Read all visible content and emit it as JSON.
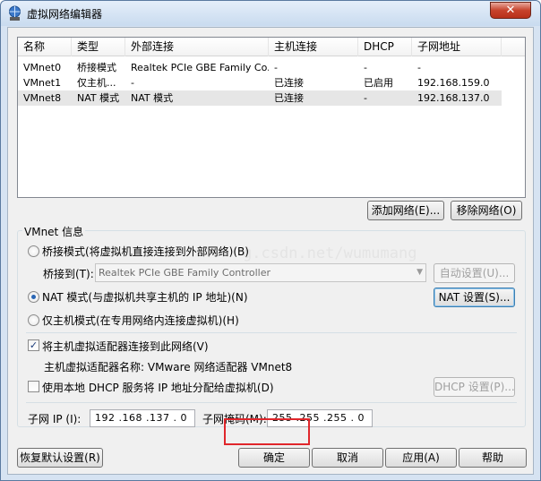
{
  "window": {
    "title": "虚拟网络编辑器",
    "close_glyph": "✕"
  },
  "table": {
    "columns": [
      "名称",
      "类型",
      "外部连接",
      "主机连接",
      "DHCP",
      "子网地址"
    ],
    "rows": [
      [
        "VMnet0",
        "桥接模式",
        "Realtek PCIe GBE Family Co...",
        "-",
        "-",
        "-"
      ],
      [
        "VMnet1",
        "仅主机...",
        "-",
        "已连接",
        "已启用",
        "192.168.159.0"
      ],
      [
        "VMnet8",
        "NAT 模式",
        "NAT 模式",
        "已连接",
        "-",
        "192.168.137.0"
      ]
    ],
    "selected_row": 2
  },
  "net_buttons": {
    "add": "添加网络(E)...",
    "remove": "移除网络(O)"
  },
  "vmnet_info": {
    "group_title": "VMnet 信息",
    "bridged_label": "桥接模式(将虚拟机直接连接到外部网络)(B)",
    "bridge_to_label": "桥接到(T):",
    "bridge_to_value": "Realtek PCIe GBE Family Controller",
    "auto_settings": "自动设置(U)...",
    "nat_label": "NAT 模式(与虚拟机共享主机的 IP 地址)(N)",
    "nat_settings": "NAT 设置(S)...",
    "hostonly_label": "仅主机模式(在专用网络内连接虚拟机)(H)",
    "connect_adapter_label": "将主机虚拟适配器连接到此网络(V)",
    "adapter_name_label": "主机虚拟适配器名称: VMware 网络适配器 VMnet8",
    "dhcp_label": "使用本地 DHCP 服务将 IP 地址分配给虚拟机(D)",
    "dhcp_settings": "DHCP 设置(P)...",
    "subnet_ip_label": "子网 IP (I):",
    "subnet_ip": "192 .168 .137 . 0",
    "subnet_mask_label": "子网掩码(M):",
    "subnet_mask": "255 .255 .255 . 0",
    "selected_mode": "nat",
    "connect_adapter_checked": true,
    "dhcp_checked": false
  },
  "watermark": "g.csdn.net/wumumang",
  "footer": {
    "restore": "恢复默认设置(R)",
    "ok": "确定",
    "cancel": "取消",
    "apply": "应用(A)",
    "help": "帮助"
  },
  "colors": {
    "titlebar": "#c9dbef",
    "close": "#c7432c",
    "highlight_box": "#e0262b",
    "selected_row": "#e6e6e6"
  }
}
